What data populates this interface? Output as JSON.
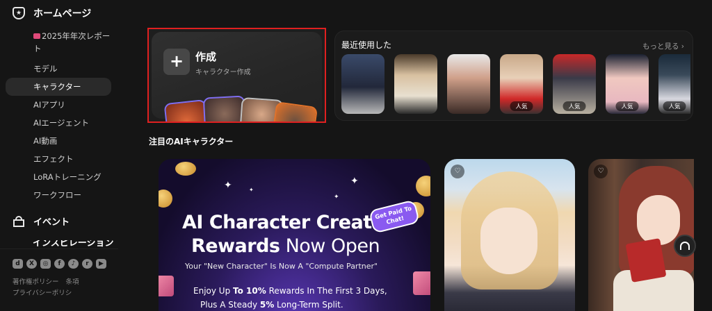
{
  "sidebar": {
    "home": "ホームページ",
    "items": [
      {
        "label": "2025年年次レポート"
      },
      {
        "label": "モデル"
      },
      {
        "label": "キャラクター"
      },
      {
        "label": "AIアプリ"
      },
      {
        "label": "AIエージェント"
      },
      {
        "label": "AI動画"
      },
      {
        "label": "エフェクト"
      },
      {
        "label": "LoRAトレーニング"
      },
      {
        "label": "ワークフロー"
      }
    ],
    "event": "イベント",
    "inspiration": "インスピレーション",
    "social_icons": [
      "discord-icon",
      "x-icon",
      "instagram-icon",
      "facebook-icon",
      "tiktok-icon",
      "reddit-icon",
      "youtube-icon"
    ],
    "legal": {
      "copyright": "著作権ポリシー",
      "terms": "条項",
      "privacy": "プライバシーポリシ"
    }
  },
  "create_card": {
    "title": "作成",
    "subtitle": "キャラクター作成"
  },
  "recent": {
    "title": "最近使用した",
    "more": "もっと見る ›",
    "thumbs": [
      {
        "tag": ""
      },
      {
        "tag": ""
      },
      {
        "tag": ""
      },
      {
        "tag": "人気"
      },
      {
        "tag": "人気"
      },
      {
        "tag": "人気"
      },
      {
        "tag": "人気"
      }
    ]
  },
  "featured": {
    "title": "注目のAIキャラクター",
    "banner": {
      "headline_1": "AI Character Creator",
      "headline_2_bold": "Rewards",
      "headline_2_rest": " Now Open",
      "pill": "Get Paid To Chat!",
      "subline": "Your \"New Character\" Is Now A \"Compute Partner\"",
      "line1_pre": "Enjoy Up ",
      "line1_bold": "To 10%",
      "line1_post": " Rewards In The First 3 Days,",
      "line2_pre": "Plus A Steady ",
      "line2_bold": "5%",
      "line2_post": " Long-Term Split."
    }
  },
  "colors": {
    "accent_red": "#e02020",
    "background": "#151515",
    "card": "#1b1b1b"
  }
}
